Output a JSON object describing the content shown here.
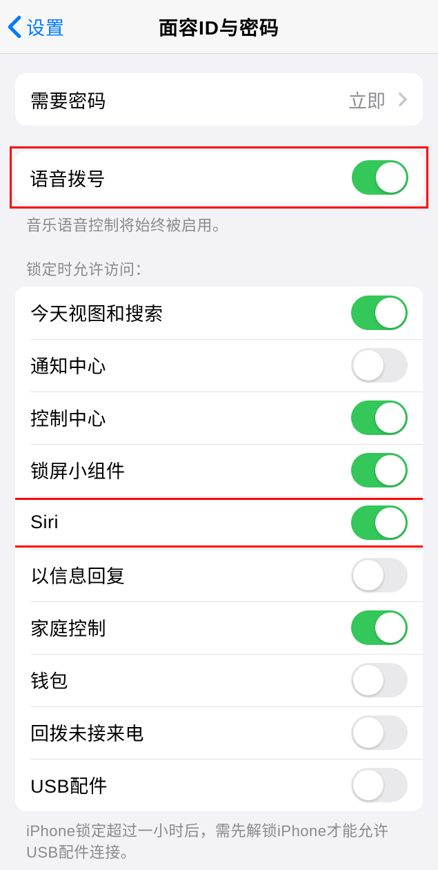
{
  "nav": {
    "back": "设置",
    "title": "面容ID与密码"
  },
  "passcode": {
    "label": "需要密码",
    "value": "立即"
  },
  "voice_dial": {
    "label": "语音拨号",
    "on": true,
    "footer": "音乐语音控制将始终被启用。"
  },
  "locked_header": "锁定时允许访问：",
  "locked_items": [
    {
      "label": "今天视图和搜索",
      "on": true
    },
    {
      "label": "通知中心",
      "on": false
    },
    {
      "label": "控制中心",
      "on": true
    },
    {
      "label": "锁屏小组件",
      "on": true
    },
    {
      "label": "Siri",
      "on": true,
      "highlight": true
    },
    {
      "label": "以信息回复",
      "on": false
    },
    {
      "label": "家庭控制",
      "on": true
    },
    {
      "label": "钱包",
      "on": false
    },
    {
      "label": "回拨未接来电",
      "on": false
    },
    {
      "label": "USB配件",
      "on": false
    }
  ],
  "usb_footer": "iPhone锁定超过一小时后，需先解锁iPhone才能允许USB配件连接。"
}
